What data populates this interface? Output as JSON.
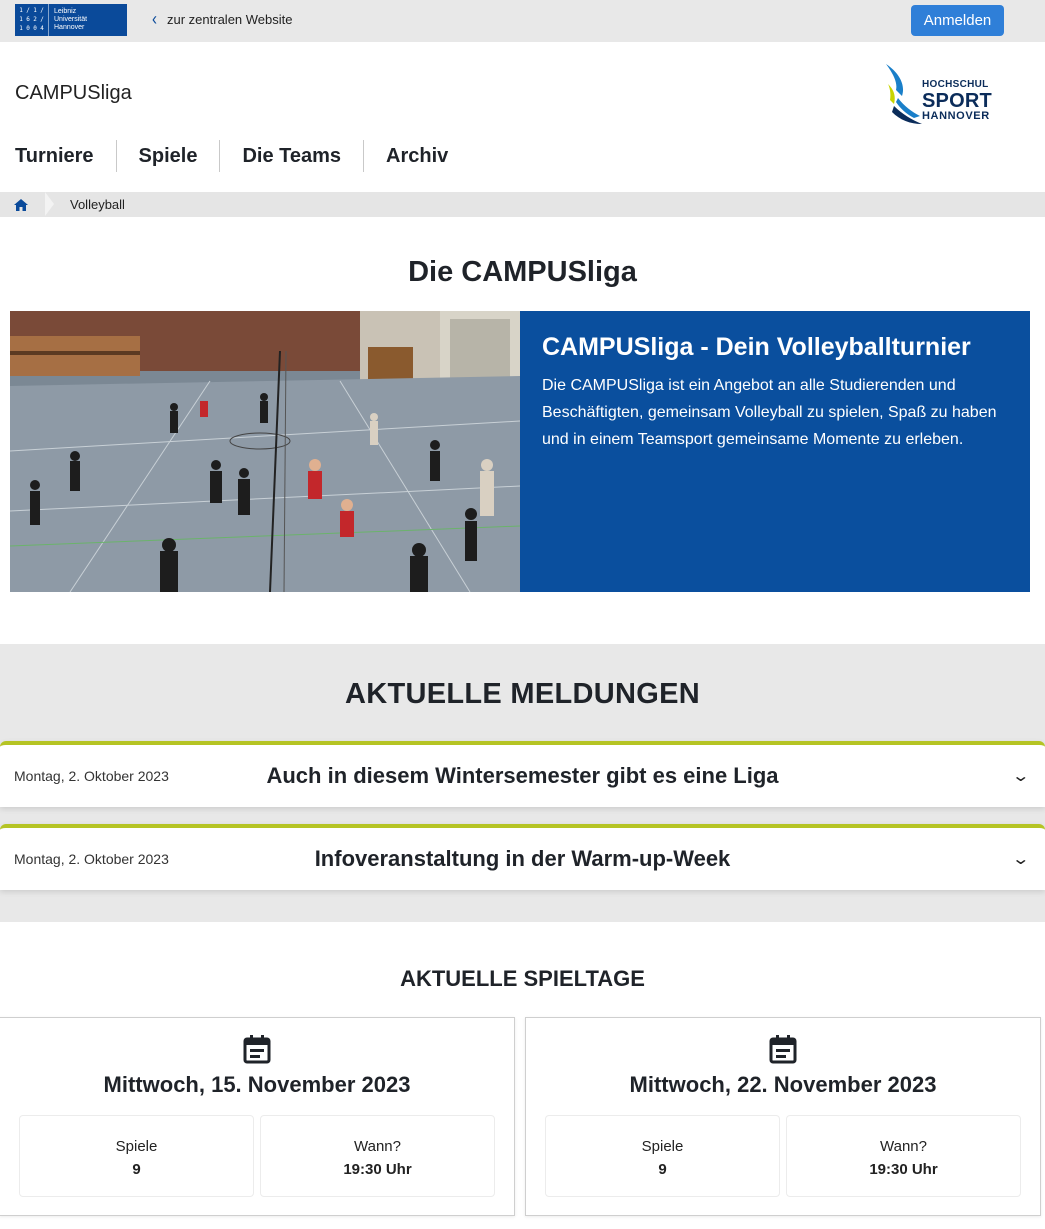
{
  "topbar": {
    "luh_logo": {
      "digits": [
        "1",
        "/",
        "1",
        "/",
        "1",
        "6",
        "2",
        "/",
        "1",
        "0",
        "0",
        "4"
      ],
      "lines": [
        "Leibniz",
        "Universität",
        "Hannover"
      ]
    },
    "back_link": "zur zentralen Website",
    "login_label": "Anmelden"
  },
  "header": {
    "site_title": "CAMPUSliga",
    "hs_logo": {
      "line1": "HOCHSCHUL",
      "line2": "SPORT",
      "line3": "HANNOVER"
    }
  },
  "nav": {
    "items": [
      {
        "label": "Turniere"
      },
      {
        "label": "Spiele"
      },
      {
        "label": "Die Teams"
      },
      {
        "label": "Archiv"
      }
    ]
  },
  "breadcrumb": {
    "current": "Volleyball"
  },
  "intro": {
    "heading": "Die CAMPUSliga",
    "box_title": "CAMPUSliga - Dein Volleyballturnier",
    "box_text": "Die CAMPUSliga ist ein Angebot an alle Studierenden und Beschäftigten, gemeinsam Volleyball zu spielen, Spaß zu haben und in einem Teamsport gemeinsame Momente zu erleben."
  },
  "news": {
    "heading": "AKTUELLE MELDUNGEN",
    "items": [
      {
        "date": "Montag, 2. Oktober 2023",
        "title": "Auch in diesem Wintersemester gibt es eine Liga"
      },
      {
        "date": "Montag, 2. Oktober 2023",
        "title": "Infoveranstaltung in der Warm-up-Week"
      }
    ]
  },
  "spieltage": {
    "heading": "AKTUELLE SPIELTAGE",
    "cards": [
      {
        "date": "Mittwoch, 15. November 2023",
        "games_label": "Spiele",
        "games_value": "9",
        "time_label": "Wann?",
        "time_value": "19:30 Uhr"
      },
      {
        "date": "Mittwoch, 22. November 2023",
        "games_label": "Spiele",
        "games_value": "9",
        "time_label": "Wann?",
        "time_value": "19:30 Uhr"
      }
    ]
  },
  "colors": {
    "primary_blue": "#0a4f9e",
    "button_blue": "#2f7fd8",
    "accent_green": "#b5c424",
    "gray_band": "#e8e8e8"
  }
}
